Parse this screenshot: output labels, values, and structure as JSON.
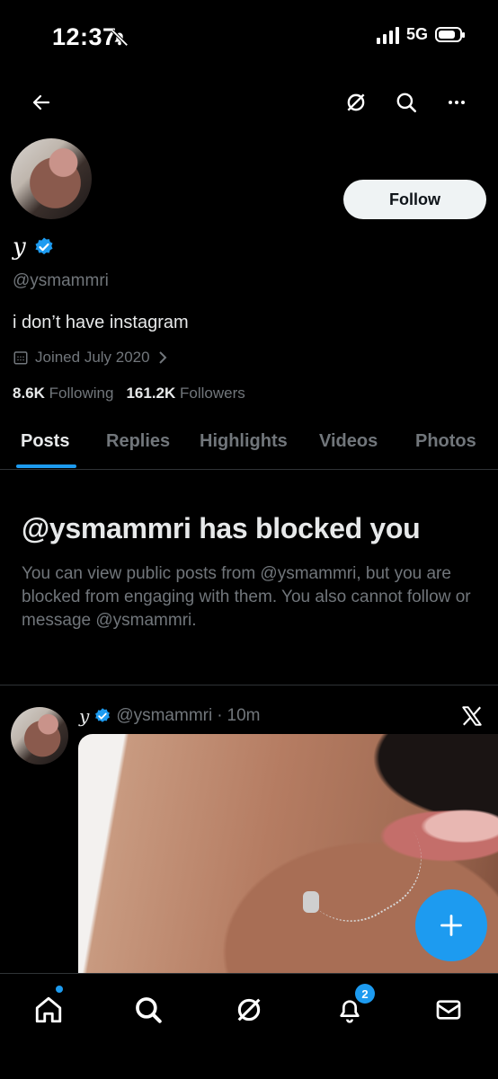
{
  "status_bar": {
    "time": "12:37",
    "network": "5G"
  },
  "profile": {
    "display_name": "y",
    "handle": "@ysmammri",
    "bio": "i don’t have instagram",
    "joined": "Joined July 2020",
    "following_count": "8.6K",
    "following_label": "Following",
    "followers_count": "161.2K",
    "followers_label": "Followers",
    "follow_label": "Follow"
  },
  "tabs": [
    {
      "label": "Posts",
      "active": true
    },
    {
      "label": "Replies"
    },
    {
      "label": "Highlights"
    },
    {
      "label": "Videos"
    },
    {
      "label": "Photos"
    }
  ],
  "blocked": {
    "title": "@ysmammri has blocked you",
    "message": "You can view public posts from @ysmammri, but you are blocked from engaging with them. You also cannot follow or message @ysmammri."
  },
  "post": {
    "author_name": "y",
    "handle": "@ysmammri",
    "separator": "·",
    "time": "10m"
  },
  "bottom_nav": {
    "notification_count": "2"
  },
  "colors": {
    "accent": "#1d9bf0",
    "background": "#000000",
    "muted": "#71767b"
  },
  "icons": [
    "back-arrow-icon",
    "grok-icon",
    "search-icon",
    "more-icon",
    "verified-icon",
    "calendar-icon",
    "x-logo-icon",
    "compose-icon",
    "home-icon",
    "notifications-icon",
    "messages-icon"
  ]
}
